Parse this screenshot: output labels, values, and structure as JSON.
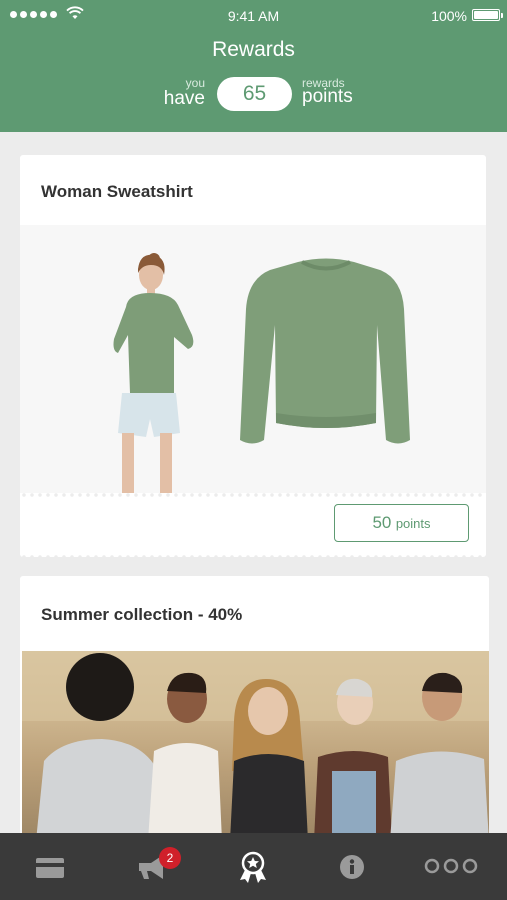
{
  "status_bar": {
    "time": "9:41 AM",
    "battery": "100%"
  },
  "header": {
    "title": "Rewards",
    "you": "you",
    "have": "have",
    "points_value": "65",
    "rewards_small": "rewards",
    "points_label": "points"
  },
  "cards": [
    {
      "title": "Woman Sweatshirt",
      "points_num": "50",
      "points_unit": "points"
    },
    {
      "title": "Summer collection - 40%"
    }
  ],
  "tabbar": {
    "items": [
      {
        "icon": "card-icon"
      },
      {
        "icon": "megaphone-icon",
        "badge": "2"
      },
      {
        "icon": "rewards-ribbon-icon"
      },
      {
        "icon": "info-icon"
      },
      {
        "icon": "more-icon"
      }
    ],
    "active_index": 2
  },
  "colors": {
    "accent": "#5e9a72",
    "tabbar": "#3a3a3a",
    "badge": "#d0202a"
  }
}
